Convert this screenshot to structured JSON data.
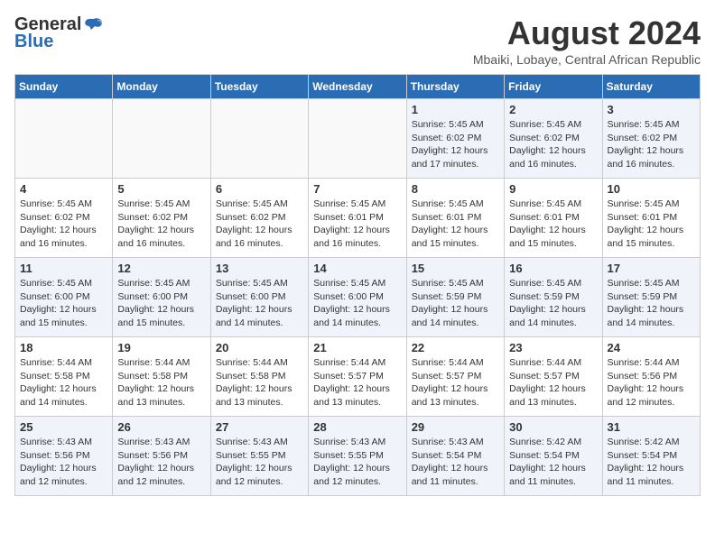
{
  "logo": {
    "general": "General",
    "blue": "Blue"
  },
  "title": {
    "month_year": "August 2024",
    "location": "Mbaiki, Lobaye, Central African Republic"
  },
  "days_of_week": [
    "Sunday",
    "Monday",
    "Tuesday",
    "Wednesday",
    "Thursday",
    "Friday",
    "Saturday"
  ],
  "weeks": [
    [
      {
        "day": "",
        "info": ""
      },
      {
        "day": "",
        "info": ""
      },
      {
        "day": "",
        "info": ""
      },
      {
        "day": "",
        "info": ""
      },
      {
        "day": "1",
        "info": "Sunrise: 5:45 AM\nSunset: 6:02 PM\nDaylight: 12 hours\nand 17 minutes."
      },
      {
        "day": "2",
        "info": "Sunrise: 5:45 AM\nSunset: 6:02 PM\nDaylight: 12 hours\nand 16 minutes."
      },
      {
        "day": "3",
        "info": "Sunrise: 5:45 AM\nSunset: 6:02 PM\nDaylight: 12 hours\nand 16 minutes."
      }
    ],
    [
      {
        "day": "4",
        "info": "Sunrise: 5:45 AM\nSunset: 6:02 PM\nDaylight: 12 hours\nand 16 minutes."
      },
      {
        "day": "5",
        "info": "Sunrise: 5:45 AM\nSunset: 6:02 PM\nDaylight: 12 hours\nand 16 minutes."
      },
      {
        "day": "6",
        "info": "Sunrise: 5:45 AM\nSunset: 6:02 PM\nDaylight: 12 hours\nand 16 minutes."
      },
      {
        "day": "7",
        "info": "Sunrise: 5:45 AM\nSunset: 6:01 PM\nDaylight: 12 hours\nand 16 minutes."
      },
      {
        "day": "8",
        "info": "Sunrise: 5:45 AM\nSunset: 6:01 PM\nDaylight: 12 hours\nand 15 minutes."
      },
      {
        "day": "9",
        "info": "Sunrise: 5:45 AM\nSunset: 6:01 PM\nDaylight: 12 hours\nand 15 minutes."
      },
      {
        "day": "10",
        "info": "Sunrise: 5:45 AM\nSunset: 6:01 PM\nDaylight: 12 hours\nand 15 minutes."
      }
    ],
    [
      {
        "day": "11",
        "info": "Sunrise: 5:45 AM\nSunset: 6:00 PM\nDaylight: 12 hours\nand 15 minutes."
      },
      {
        "day": "12",
        "info": "Sunrise: 5:45 AM\nSunset: 6:00 PM\nDaylight: 12 hours\nand 15 minutes."
      },
      {
        "day": "13",
        "info": "Sunrise: 5:45 AM\nSunset: 6:00 PM\nDaylight: 12 hours\nand 14 minutes."
      },
      {
        "day": "14",
        "info": "Sunrise: 5:45 AM\nSunset: 6:00 PM\nDaylight: 12 hours\nand 14 minutes."
      },
      {
        "day": "15",
        "info": "Sunrise: 5:45 AM\nSunset: 5:59 PM\nDaylight: 12 hours\nand 14 minutes."
      },
      {
        "day": "16",
        "info": "Sunrise: 5:45 AM\nSunset: 5:59 PM\nDaylight: 12 hours\nand 14 minutes."
      },
      {
        "day": "17",
        "info": "Sunrise: 5:45 AM\nSunset: 5:59 PM\nDaylight: 12 hours\nand 14 minutes."
      }
    ],
    [
      {
        "day": "18",
        "info": "Sunrise: 5:44 AM\nSunset: 5:58 PM\nDaylight: 12 hours\nand 14 minutes."
      },
      {
        "day": "19",
        "info": "Sunrise: 5:44 AM\nSunset: 5:58 PM\nDaylight: 12 hours\nand 13 minutes."
      },
      {
        "day": "20",
        "info": "Sunrise: 5:44 AM\nSunset: 5:58 PM\nDaylight: 12 hours\nand 13 minutes."
      },
      {
        "day": "21",
        "info": "Sunrise: 5:44 AM\nSunset: 5:57 PM\nDaylight: 12 hours\nand 13 minutes."
      },
      {
        "day": "22",
        "info": "Sunrise: 5:44 AM\nSunset: 5:57 PM\nDaylight: 12 hours\nand 13 minutes."
      },
      {
        "day": "23",
        "info": "Sunrise: 5:44 AM\nSunset: 5:57 PM\nDaylight: 12 hours\nand 13 minutes."
      },
      {
        "day": "24",
        "info": "Sunrise: 5:44 AM\nSunset: 5:56 PM\nDaylight: 12 hours\nand 12 minutes."
      }
    ],
    [
      {
        "day": "25",
        "info": "Sunrise: 5:43 AM\nSunset: 5:56 PM\nDaylight: 12 hours\nand 12 minutes."
      },
      {
        "day": "26",
        "info": "Sunrise: 5:43 AM\nSunset: 5:56 PM\nDaylight: 12 hours\nand 12 minutes."
      },
      {
        "day": "27",
        "info": "Sunrise: 5:43 AM\nSunset: 5:55 PM\nDaylight: 12 hours\nand 12 minutes."
      },
      {
        "day": "28",
        "info": "Sunrise: 5:43 AM\nSunset: 5:55 PM\nDaylight: 12 hours\nand 12 minutes."
      },
      {
        "day": "29",
        "info": "Sunrise: 5:43 AM\nSunset: 5:54 PM\nDaylight: 12 hours\nand 11 minutes."
      },
      {
        "day": "30",
        "info": "Sunrise: 5:42 AM\nSunset: 5:54 PM\nDaylight: 12 hours\nand 11 minutes."
      },
      {
        "day": "31",
        "info": "Sunrise: 5:42 AM\nSunset: 5:54 PM\nDaylight: 12 hours\nand 11 minutes."
      }
    ]
  ]
}
